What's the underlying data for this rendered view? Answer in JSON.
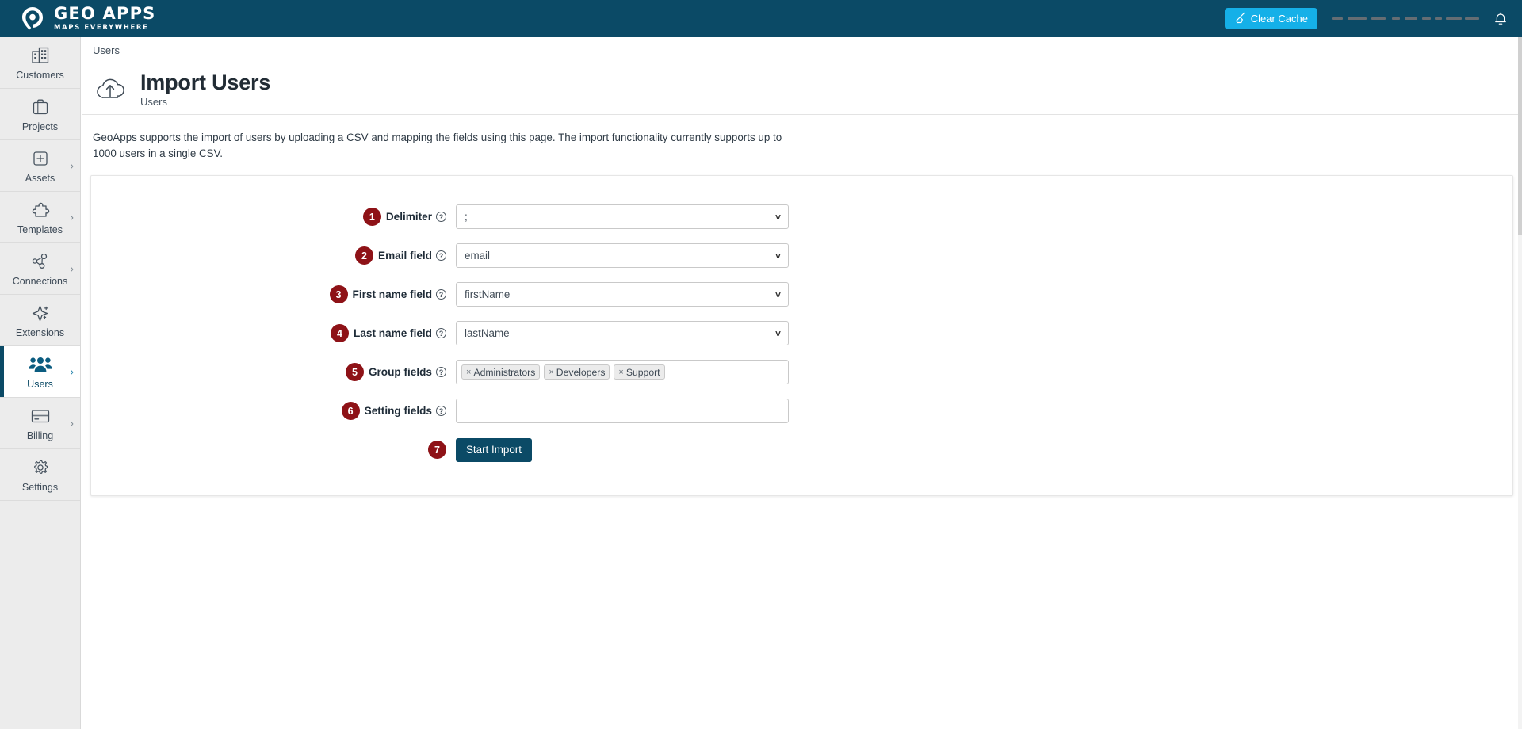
{
  "brand": {
    "name": "GEO APPS",
    "tagline": "MAPS EVERYWHERE",
    "accent_primary": "#0b4a66",
    "accent_cyan": "#15b0e8",
    "badge_red": "#8e1217"
  },
  "topbar": {
    "clear_cache_label": "Clear Cache",
    "broom_icon": "broom-icon",
    "notifications_icon": "bell-icon",
    "user_name_redacted": ""
  },
  "sidebar": {
    "items": [
      {
        "label": "Customers",
        "icon": "buildings-icon",
        "has_chevron": false,
        "active": false
      },
      {
        "label": "Projects",
        "icon": "briefcase-icon",
        "has_chevron": false,
        "active": false
      },
      {
        "label": "Assets",
        "icon": "plus-square-icon",
        "has_chevron": true,
        "active": false
      },
      {
        "label": "Templates",
        "icon": "puzzle-icon",
        "has_chevron": true,
        "active": false
      },
      {
        "label": "Connections",
        "icon": "network-icon",
        "has_chevron": true,
        "active": false
      },
      {
        "label": "Extensions",
        "icon": "sparkle-icon",
        "has_chevron": false,
        "active": false
      },
      {
        "label": "Users",
        "icon": "users-icon",
        "has_chevron": true,
        "active": true
      },
      {
        "label": "Billing",
        "icon": "credit-card-icon",
        "has_chevron": true,
        "active": false
      },
      {
        "label": "Settings",
        "icon": "gear-icon",
        "has_chevron": false,
        "active": false
      }
    ]
  },
  "main": {
    "breadcrumb": "Users",
    "page_title": "Import Users",
    "page_subtitle": "Users",
    "page_icon": "cloud-upload-icon",
    "intro": "GeoApps supports the import of users by uploading a CSV and mapping the fields using this page. The import functionality currently supports up to 1000 users in a single CSV.",
    "form": {
      "rows": [
        {
          "step": "1",
          "label": "Delimiter",
          "help_icon": "question-circle-icon",
          "type": "select",
          "value": ";",
          "placeholder": ""
        },
        {
          "step": "2",
          "label": "Email field",
          "help_icon": "question-circle-icon",
          "type": "select",
          "value": "email",
          "placeholder": ""
        },
        {
          "step": "3",
          "label": "First name field",
          "help_icon": "question-circle-icon",
          "type": "select",
          "value": "firstName",
          "placeholder": ""
        },
        {
          "step": "4",
          "label": "Last name field",
          "help_icon": "question-circle-icon",
          "type": "select",
          "value": "lastName",
          "placeholder": ""
        },
        {
          "step": "5",
          "label": "Group fields",
          "help_icon": "question-circle-icon",
          "type": "tags",
          "tags": [
            "Administrators",
            "Developers",
            "Support"
          ],
          "placeholder": ""
        },
        {
          "step": "6",
          "label": "Setting fields",
          "help_icon": "question-circle-icon",
          "type": "tags",
          "tags": [],
          "placeholder": ""
        }
      ],
      "submit": {
        "step": "7",
        "label": "Start Import"
      }
    }
  }
}
